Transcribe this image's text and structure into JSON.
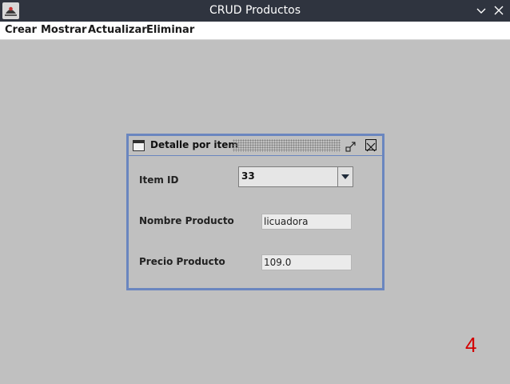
{
  "window": {
    "title": "CRUD Productos"
  },
  "menu": {
    "items": [
      {
        "label": "Crear"
      },
      {
        "label": "Mostrar"
      },
      {
        "label": "Actualizar"
      },
      {
        "label": "Eliminar"
      }
    ]
  },
  "internal_frame": {
    "title": "Detalle por item",
    "fields": {
      "item_id_label": "Item ID",
      "item_id_value": "33",
      "nombre_label": "Nombre Producto",
      "nombre_value": "licuadora",
      "precio_label": "Precio Producto",
      "precio_value": "109.0"
    }
  },
  "overlay_number": "4",
  "colors": {
    "titlebar": "#2f343f",
    "desktop": "#c0c0c0",
    "frame_border": "#6a86bf",
    "overlay_number": "#d30000"
  }
}
